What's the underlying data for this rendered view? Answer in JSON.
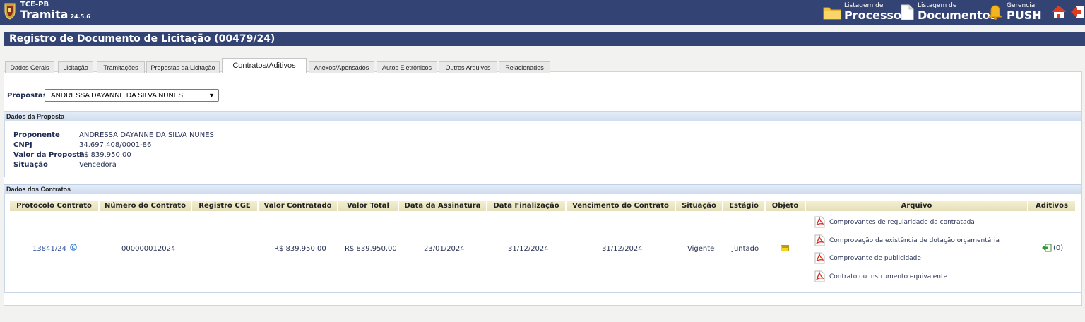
{
  "app": {
    "org": "TCE-PB",
    "name": "Tramita",
    "version": "24.5.6"
  },
  "topnav": {
    "processos": {
      "small": "Listagem de",
      "big": "Processos"
    },
    "documentos": {
      "small": "Listagem de",
      "big": "Documentos"
    },
    "push": {
      "small": "Gerenciar",
      "big": "PUSH"
    }
  },
  "page_title": "Registro de Documento de Licitação (00479/24)",
  "tabs": [
    "Dados Gerais",
    "Licitação",
    "Tramitações",
    "Propostas da Licitação",
    "Contratos/Aditivos",
    "Anexos/Apensados",
    "Autos Eletrônicos",
    "Outros Arquivos",
    "Relacionados"
  ],
  "active_tab": "Contratos/Aditivos",
  "propostas": {
    "label": "Propostas",
    "selected": "ANDRESSA DAYANNE DA SILVA NUNES"
  },
  "dados_proposta": {
    "header": "Dados da Proposta",
    "proponente_label": "Proponente",
    "proponente": "ANDRESSA DAYANNE DA SILVA NUNES",
    "cnpj_label": "CNPJ",
    "cnpj": "34.697.408/0001-86",
    "valor_label": "Valor da Proposta",
    "valor": "R$ 839.950,00",
    "situacao_label": "Situação",
    "situacao": "Vencedora"
  },
  "contratos": {
    "header": "Dados dos Contratos",
    "columns": [
      "Protocolo Contrato",
      "Número do Contrato",
      "Registro CGE",
      "Valor Contratado",
      "Valor Total",
      "Data da Assinatura",
      "Data Finalização",
      "Vencimento do Contrato",
      "Situação",
      "Estágio",
      "Objeto",
      "Arquivo",
      "Aditivos"
    ],
    "row": {
      "protocolo": "13841/24",
      "numero": "000000012024",
      "registro_cge": "",
      "valor_contratado": "R$ 839.950,00",
      "valor_total": "R$ 839.950,00",
      "data_assinatura": "23/01/2024",
      "data_finalizacao": "31/12/2024",
      "vencimento": "31/12/2024",
      "situacao": "Vigente",
      "estagio": "Juntado",
      "arquivos": [
        "Comprovantes de regularidade da contratada",
        "Comprovação da existência de dotação orçamentária",
        "Comprovante de publicidade",
        "Contrato ou instrumento equivalente"
      ],
      "aditivos": "(0)"
    }
  },
  "colors": {
    "header_bg": "#334474",
    "table_header_bg": "#ebe6c4",
    "link": "#2f4f9a"
  }
}
